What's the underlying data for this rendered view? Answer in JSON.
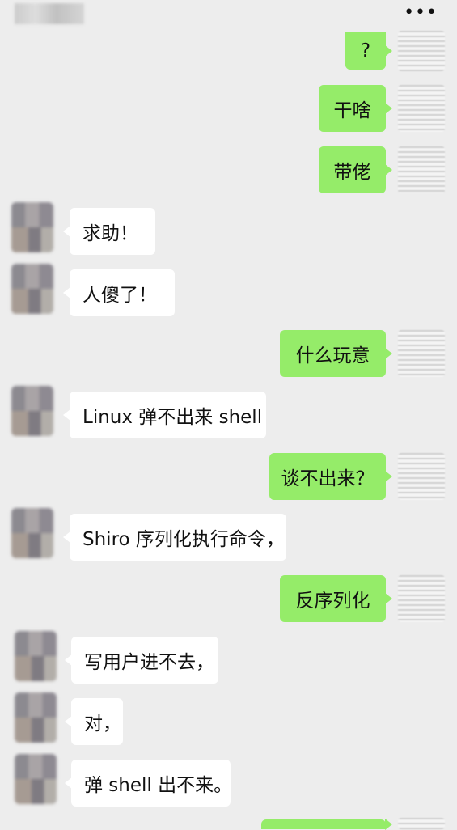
{
  "header": {
    "more_icon": "more-icon"
  },
  "messages": [
    {
      "side": "out",
      "text": "?"
    },
    {
      "side": "out",
      "text": "干啥"
    },
    {
      "side": "out",
      "text": "带佬"
    },
    {
      "side": "in",
      "text": "求助！"
    },
    {
      "side": "in",
      "text": "人傻了！"
    },
    {
      "side": "out",
      "text": "什么玩意"
    },
    {
      "side": "in",
      "text": "Linux 弹不出来 shell"
    },
    {
      "side": "out",
      "text": "谈不出来？"
    },
    {
      "side": "in",
      "text": "Shiro 序列化执行命令，"
    },
    {
      "side": "out",
      "text": "反序列化"
    },
    {
      "side": "in",
      "text": "写用户进不去，"
    },
    {
      "side": "in",
      "text": "对，"
    },
    {
      "side": "in",
      "text": "弹 shell 出不来。"
    },
    {
      "side": "out",
      "text": ""
    }
  ]
}
